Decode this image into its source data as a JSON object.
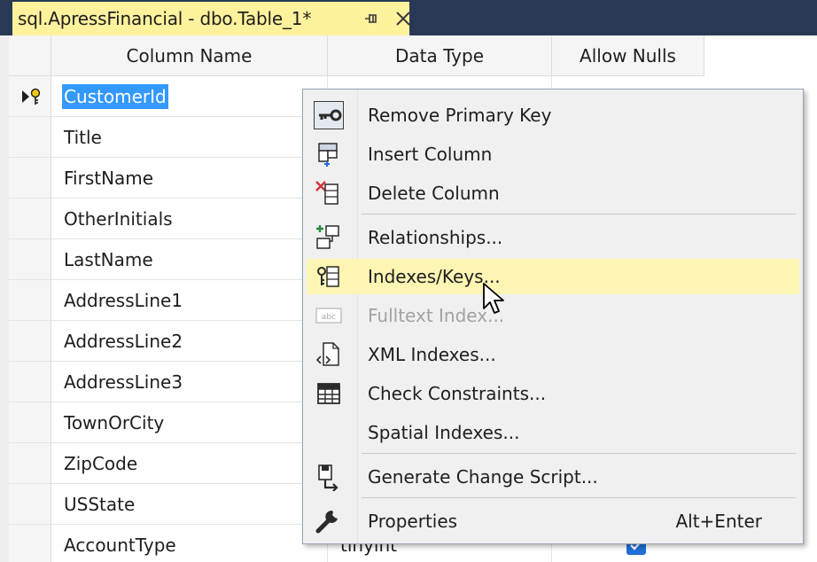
{
  "tab": {
    "title": "sql.ApressFinancial - dbo.Table_1*",
    "pin_icon": "pin-icon",
    "close_icon": "close-icon"
  },
  "grid": {
    "headers": [
      "Column Name",
      "Data Type",
      "Allow Nulls"
    ],
    "rows": [
      {
        "name": "CustomerId",
        "type": "",
        "allow_nulls": false,
        "primary_key": true,
        "selected": true
      },
      {
        "name": "Title",
        "type": "",
        "allow_nulls": false
      },
      {
        "name": "FirstName",
        "type": "",
        "allow_nulls": false
      },
      {
        "name": "OtherInitials",
        "type": "",
        "allow_nulls": false
      },
      {
        "name": "LastName",
        "type": "",
        "allow_nulls": false
      },
      {
        "name": "AddressLine1",
        "type": "",
        "allow_nulls": false
      },
      {
        "name": "AddressLine2",
        "type": "",
        "allow_nulls": false
      },
      {
        "name": "AddressLine3",
        "type": "",
        "allow_nulls": false
      },
      {
        "name": "TownOrCity",
        "type": "",
        "allow_nulls": false
      },
      {
        "name": "ZipCode",
        "type": "",
        "allow_nulls": false
      },
      {
        "name": "USState",
        "type": "",
        "allow_nulls": false
      },
      {
        "name": "AccountType",
        "type": "tinyint",
        "allow_nulls": true
      }
    ]
  },
  "context_menu": {
    "items": [
      {
        "label": "Remove Primary Key",
        "icon": "key-icon",
        "highlighted": false,
        "disabled": false
      },
      {
        "label": "Insert Column",
        "icon": "insert-column-icon",
        "highlighted": false,
        "disabled": false
      },
      {
        "label": "Delete Column",
        "icon": "delete-column-icon",
        "highlighted": false,
        "disabled": false
      },
      {
        "label": "Relationships...",
        "icon": "relationships-icon",
        "highlighted": false,
        "disabled": false
      },
      {
        "label": "Indexes/Keys...",
        "icon": "indexes-keys-icon",
        "highlighted": true,
        "disabled": false
      },
      {
        "label": "Fulltext Index...",
        "icon": "fulltext-index-icon",
        "highlighted": false,
        "disabled": true
      },
      {
        "label": "XML Indexes...",
        "icon": "xml-indexes-icon",
        "highlighted": false,
        "disabled": false
      },
      {
        "label": "Check Constraints...",
        "icon": "check-constraints-icon",
        "highlighted": false,
        "disabled": false
      },
      {
        "label": "Spatial Indexes...",
        "icon": "",
        "highlighted": false,
        "disabled": false
      },
      {
        "label": "Generate Change Script...",
        "icon": "generate-script-icon",
        "highlighted": false,
        "disabled": false
      },
      {
        "label": "Properties",
        "icon": "wrench-icon",
        "shortcut": "Alt+Enter",
        "highlighted": false,
        "disabled": false
      }
    ]
  },
  "colors": {
    "tab_strip": "#293955",
    "active_tab": "#fff29d",
    "selection": "#3399ff",
    "menu_highlight": "#fcf5b3",
    "checkbox": "#1f6fd6"
  }
}
